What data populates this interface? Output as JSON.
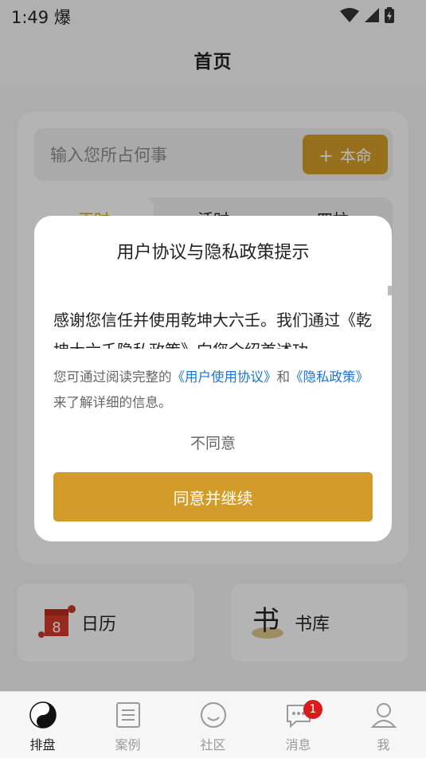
{
  "status": {
    "time": "1:49",
    "extra": "爆"
  },
  "header": {
    "title": "首页"
  },
  "search": {
    "placeholder": "输入您所占何事",
    "button_label": "本命",
    "button_plus": "+"
  },
  "tabs": [
    {
      "label": "正时"
    },
    {
      "label": "活时"
    },
    {
      "label": "四柱"
    }
  ],
  "features": [
    {
      "label": "日历",
      "icon_text": "8"
    },
    {
      "label": "书库",
      "icon_text": "书"
    }
  ],
  "dialog": {
    "title": "用户协议与隐私政策提示",
    "body": "感谢您信任并使用乾坤大六壬。我们通过《乾坤大六壬隐私政策》向您介绍首述功",
    "note_prefix": "您可通过阅读完整的",
    "link_terms": "《用户使用协议》",
    "note_and": "和",
    "link_privacy": "《隐私政策》",
    "note_suffix": "来了解详细的信息。",
    "disagree_label": "不同意",
    "agree_label": "同意并继续"
  },
  "nav": [
    {
      "label": "排盘",
      "icon": "yin-yang-icon"
    },
    {
      "label": "案例",
      "icon": "document-icon"
    },
    {
      "label": "社区",
      "icon": "smile-icon"
    },
    {
      "label": "消息",
      "icon": "chat-icon",
      "badge": "1"
    },
    {
      "label": "我",
      "icon": "user-icon"
    }
  ],
  "colors": {
    "accent": "#d29b2a",
    "link": "#1a73d9",
    "badge": "#d81b1b"
  }
}
